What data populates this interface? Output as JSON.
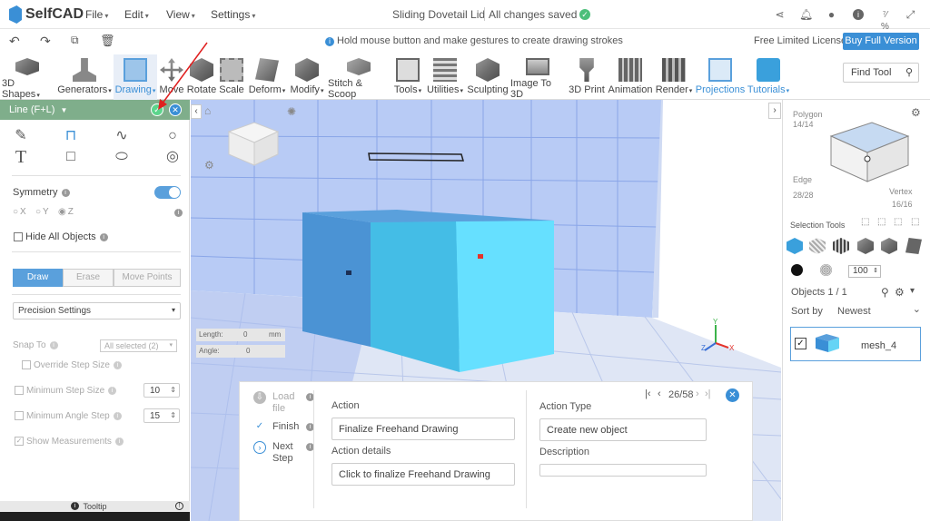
{
  "app": {
    "name": "SelfCAD",
    "brand_color": "#3a8fd6"
  },
  "menus": [
    "File",
    "Edit",
    "View",
    "Settings"
  ],
  "document": {
    "title": "Sliding Dovetail Lid",
    "status": "All changes saved"
  },
  "hint": "Hold mouse button and make gestures to create drawing strokes",
  "license": {
    "text": "Free Limited License",
    "button": "Buy Full Version"
  },
  "toolbar": {
    "items": [
      "3D Shapes",
      "Generators",
      "Drawing",
      "Move",
      "Rotate",
      "Scale",
      "Deform",
      "Modify",
      "Stitch & Scoop",
      "Tools",
      "Utilities",
      "Sculpting",
      "Image To 3D",
      "3D Print",
      "Animation",
      "Render",
      "Projections",
      "Tutorials"
    ],
    "find_tool": "Find Tool"
  },
  "left_panel": {
    "header": "Line (F+L)",
    "symmetry": "Symmetry",
    "axes": [
      "X",
      "Y",
      "Z"
    ],
    "hide_all": "Hide All Objects",
    "modes": [
      "Draw",
      "Erase",
      "Move Points"
    ],
    "precision": "Precision Settings",
    "snap_to": "Snap To",
    "snap_value": "All selected (2)",
    "override_step": "Override Step Size",
    "min_step": "Minimum Step Size",
    "min_step_value": "10",
    "min_angle": "Minimum Angle Step",
    "min_angle_value": "15",
    "show_measurements": "Show Measurements",
    "tooltip": "Tooltip"
  },
  "viewport": {
    "length_label": "Length:",
    "length_value": "0",
    "length_unit": "mm",
    "angle_label": "Angle:",
    "angle_value": "0",
    "axis_labels": [
      "Y",
      "X",
      "Z"
    ]
  },
  "dialog": {
    "steps": [
      "Load file",
      "Finish",
      "Next Step"
    ],
    "action_label": "Action",
    "action_value": "Finalize Freehand Drawing",
    "details_label": "Action details",
    "details_value": "Click to finalize Freehand Drawing",
    "type_label": "Action Type",
    "type_value": "Create new object",
    "description_label": "Description",
    "pager": "26/58"
  },
  "right_panel": {
    "polygon": "Polygon",
    "polygon_count": "14/14",
    "edge": "Edge",
    "edge_count": "28/28",
    "vertex": "Vertex",
    "vertex_count": "16/16",
    "selection_tools": "Selection Tools",
    "opacity": "100",
    "objects": "Objects 1 / 1",
    "sort_by": "Sort by",
    "sort_value": "Newest",
    "object_name": "mesh_4"
  }
}
